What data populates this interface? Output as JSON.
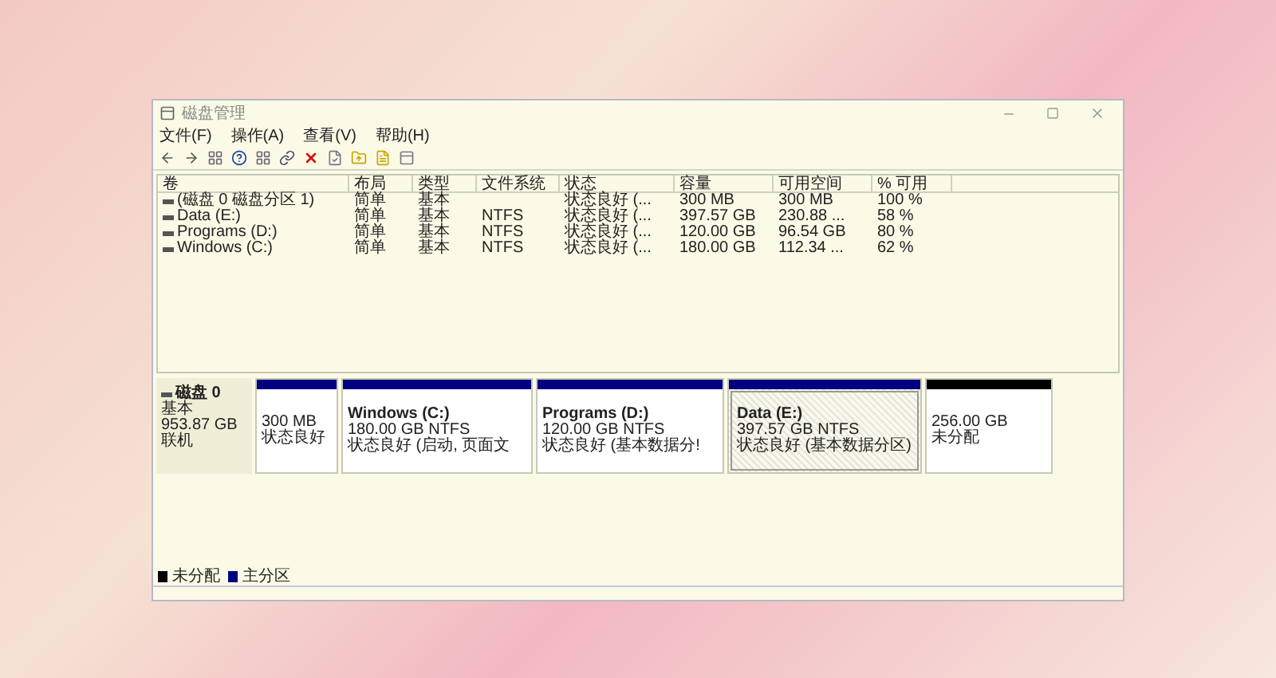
{
  "window": {
    "title": "磁盘管理"
  },
  "menu": [
    {
      "label": "文件(F)"
    },
    {
      "label": "操作(A)"
    },
    {
      "label": "查看(V)"
    },
    {
      "label": "帮助(H)"
    }
  ],
  "table": {
    "columns": [
      "卷",
      "布局",
      "类型",
      "文件系统",
      "状态",
      "容量",
      "可用空间",
      "% 可用"
    ],
    "rows": [
      [
        "(磁盘 0 磁盘分区 1)",
        "简单",
        "基本",
        "",
        "状态良好 (...",
        "300 MB",
        "300 MB",
        "100 %"
      ],
      [
        "Data (E:)",
        "简单",
        "基本",
        "NTFS",
        "状态良好 (...",
        "397.57 GB",
        "230.88 ...",
        "58 %"
      ],
      [
        "Programs (D:)",
        "简单",
        "基本",
        "NTFS",
        "状态良好 (...",
        "120.00 GB",
        "96.54 GB",
        "80 %"
      ],
      [
        "Windows (C:)",
        "简单",
        "基本",
        "NTFS",
        "状态良好 (...",
        "180.00 GB",
        "112.34 ...",
        "62 %"
      ]
    ]
  },
  "disk": {
    "name": "磁盘 0",
    "type": "基本",
    "size": "953.87 GB",
    "status": "联机",
    "partitions": [
      {
        "kind": "primary",
        "detail": "300 MB",
        "status": "状态良好",
        "selected": false
      },
      {
        "kind": "primary",
        "name": "Windows  (C:)",
        "detail": "180.00 GB NTFS",
        "status": "状态良好 (启动, 页面文",
        "selected": false
      },
      {
        "kind": "primary",
        "name": "Programs  (D:)",
        "detail": "120.00 GB NTFS",
        "status": "状态良好 (基本数据分!",
        "selected": false
      },
      {
        "kind": "primary",
        "name": "Data  (E:)",
        "detail": "397.57 GB NTFS",
        "status": "状态良好 (基本数据分区)",
        "selected": true
      },
      {
        "kind": "unallocated",
        "detail": "256.00 GB",
        "status": "未分配",
        "selected": false
      }
    ]
  },
  "legend": [
    {
      "label": "未分配",
      "color": "#000000"
    },
    {
      "label": "主分区",
      "color": "#000080"
    }
  ]
}
